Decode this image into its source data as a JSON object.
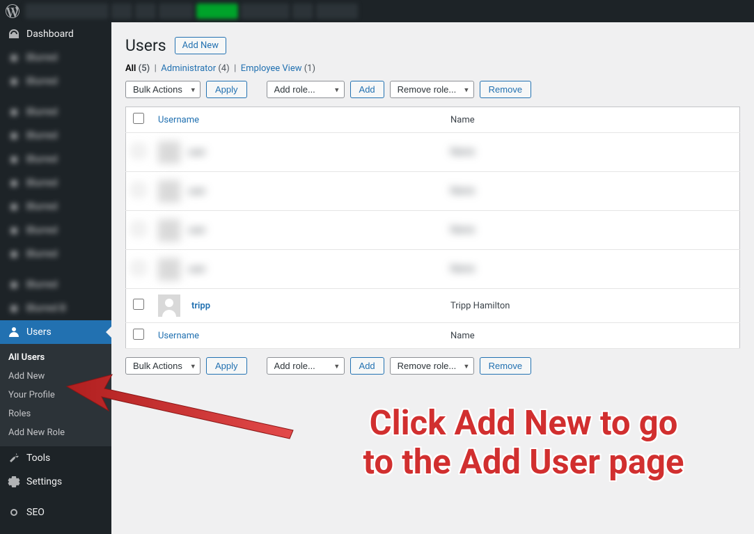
{
  "adminbar": {
    "blur_widths": [
      120,
      30,
      30,
      50,
      60,
      70,
      30,
      60
    ],
    "green_index": 4
  },
  "sidebar": {
    "dashboard": "Dashboard",
    "users": "Users",
    "tools": "Tools",
    "settings": "Settings",
    "seo": "SEO",
    "submenu": {
      "all_users": "All Users",
      "add_new": "Add New",
      "your_profile": "Your Profile",
      "roles": "Roles",
      "add_new_role": "Add New Role"
    }
  },
  "page": {
    "title": "Users",
    "add_new": "Add New"
  },
  "filters": {
    "all": "All",
    "all_count": "(5)",
    "administrator": "Administrator",
    "administrator_count": "(4)",
    "employee_view": "Employee View",
    "employee_view_count": "(1)"
  },
  "actions": {
    "bulk": "Bulk Actions",
    "apply": "Apply",
    "add_role": "Add role...",
    "add": "Add",
    "remove_role": "Remove role...",
    "remove": "Remove"
  },
  "cols": {
    "username": "Username",
    "name": "Name"
  },
  "visible_row": {
    "username": "tripp",
    "name": "Tripp Hamilton"
  },
  "annotation": {
    "line1": "Click Add New to go",
    "line2": "to the Add User page"
  }
}
